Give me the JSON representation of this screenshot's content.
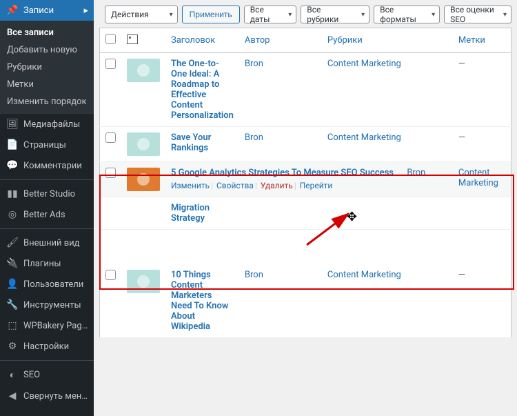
{
  "sidebar": {
    "active": {
      "label": "Записи",
      "icon": "📌"
    },
    "submenu": [
      {
        "label": "Все записи",
        "current": true
      },
      {
        "label": "Добавить новую"
      },
      {
        "label": "Рубрики"
      },
      {
        "label": "Метки"
      },
      {
        "label": "Изменить порядок"
      }
    ],
    "items": [
      {
        "label": "Медиафайлы",
        "icon": "🖼"
      },
      {
        "label": "Страницы",
        "icon": "📄"
      },
      {
        "label": "Комментарии",
        "icon": "💬"
      },
      {
        "sep": true
      },
      {
        "label": "Better Studio",
        "icon": "▮▮"
      },
      {
        "label": "Better Ads",
        "icon": "◎"
      },
      {
        "sep": true
      },
      {
        "label": "Внешний вид",
        "icon": "🖌"
      },
      {
        "label": "Плагины",
        "icon": "🔌"
      },
      {
        "label": "Пользователи",
        "icon": "👤"
      },
      {
        "label": "Инструменты",
        "icon": "🔧"
      },
      {
        "label": "WPBakery Page Builder",
        "icon": "⬚"
      },
      {
        "label": "Настройки",
        "icon": "⚙"
      },
      {
        "sep": true
      },
      {
        "label": "SEO",
        "icon": "◐"
      },
      {
        "label": "Свернуть меню",
        "icon": "◀"
      }
    ]
  },
  "toolbar": {
    "bulk": "Действия",
    "apply": "Применить",
    "dates": "Все даты",
    "cats": "Все рубрики",
    "formats": "Все форматы",
    "seo": "Все оценки SEO"
  },
  "columns": {
    "title": "Заголовок",
    "author": "Автор",
    "cat": "Рубрики",
    "tags": "Метки"
  },
  "authors": {
    "bron": "Bron"
  },
  "categories": {
    "cm": "Content Marketing"
  },
  "dash": "—",
  "rows": [
    {
      "title": "The One-to-One Ideal: A Roadmap to Effective Content Personalization",
      "author": "Bron",
      "cat": "Content Marketing",
      "thumb": "teal"
    },
    {
      "title": "Save Your Rankings",
      "author": "Bron",
      "cat": "Content Marketing",
      "thumb": "teal"
    },
    {
      "hover": true,
      "title": "5 Google Analytics Strategies To Measure SEO Success",
      "author": "Bron",
      "cat": "Content Marketing",
      "thumb": "orange",
      "actions": {
        "edit": "Изменить",
        "props": "Свойства",
        "del": "Удалить",
        "view": "Перейти"
      }
    },
    {
      "title": "Migration Strategy"
    },
    {
      "title": "10 Things Content Marketers Need To Know About Wikipedia",
      "author": "Bron",
      "cat": "Content Marketing",
      "thumb": "teal"
    }
  ]
}
